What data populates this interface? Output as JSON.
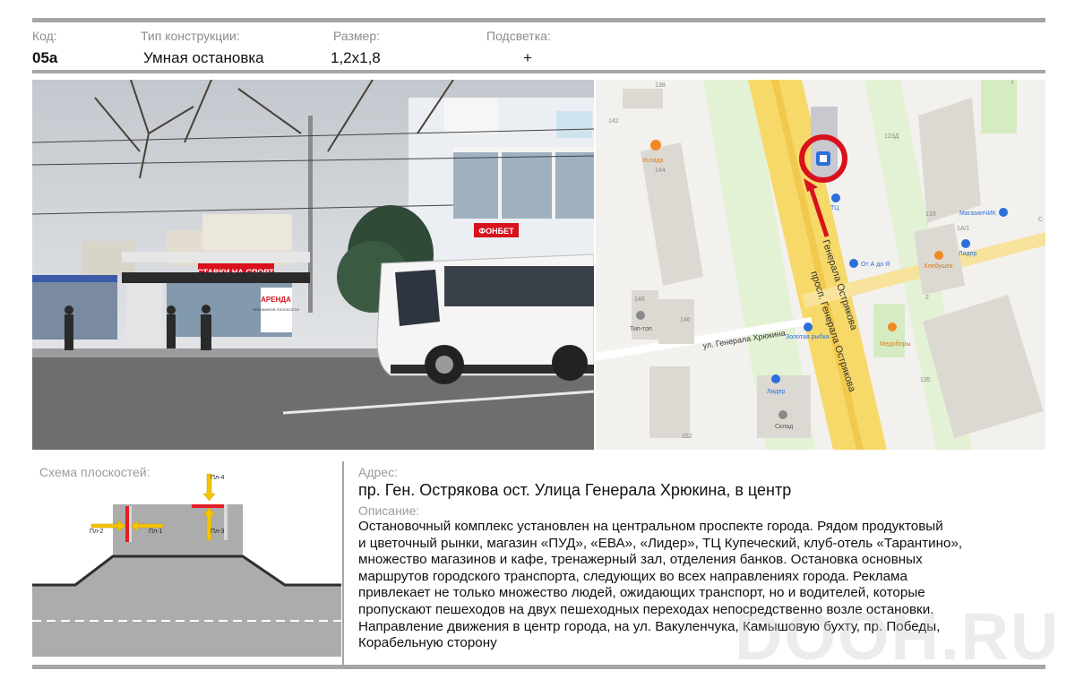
{
  "header": {
    "code_label": "Код:",
    "code_value": "05а",
    "type_label": "Тип конструкции:",
    "type_value": "Умная остановка",
    "size_label": "Размер:",
    "size_value": "1,2х1,8",
    "light_label": "Подсветка:",
    "light_value": "+"
  },
  "photo": {
    "sign_text": "СТАВКИ НА СПОРТ",
    "banner_text": "ФОНБЕТ",
    "kiosk_text": "АРЕНДА",
    "kiosk_sub": "РЕКЛАМНОЙ ПЛОСКОСТИ"
  },
  "map": {
    "street_main_1": "Генерала Острякова",
    "street_main_2": "просп. Генерала Острякова",
    "street_side": "ул. Генерала Хрюкина",
    "places": {
      "uslada": "Услада",
      "tc": "ТЦ",
      "magazin": "МагазинЧИК",
      "ot_a_do_ya": "От А до Я",
      "hlebushek": "Хлебушек",
      "lider_1": "Лидер",
      "lider_2": "Лидер",
      "tip_top": "Тип-топ",
      "zolotaya_rybka": "Золотая рыбка",
      "medobory": "Медоборы",
      "sklad": "Склад"
    },
    "houses": [
      "138",
      "142",
      "144",
      "123Д",
      "133",
      "1А/1",
      "148",
      "146",
      "2",
      "135",
      "152",
      "1",
      "С"
    ]
  },
  "scheme": {
    "title": "Схема плоскостей:",
    "planes": [
      "Пл-1",
      "Пл-2",
      "Пл-3",
      "Пл-4"
    ]
  },
  "address": {
    "label": "Адрес:",
    "value": "пр. Ген. Острякова ост. Улица Генерала Хрюкина, в центр"
  },
  "description": {
    "label": "Описание:",
    "lines": [
      "Остановочный комплекс установлен на центральном проспекте города. Рядом  продуктовый",
      "и цветочный рынки, магазин «ПУД»,  «ЕВА», «Лидер», ТЦ Купеческий, клуб-отель «Тарантино»,",
      "множество магазинов и кафе, тренажерный зал, отделения банков. Остановка основных",
      "маршрутов городского транспорта, следующих во всех направлениях города. Реклама",
      "привлекает не только множество людей, ожидающих транспорт, но и водителей, которые",
      "пропускают пешеходов на двух пешеходных переходах непосредственно возле остановки.",
      "Направление движения в центр города, на ул. Вакуленчука, Камышовую бухту, пр. Победы,",
      "Корабельную сторону"
    ]
  },
  "watermark": "DOOH.RU",
  "colors": {
    "rule": "#a6a6a6",
    "marker": "#d8111d",
    "plane": "#e31e24",
    "arrow": "#f5c400"
  }
}
